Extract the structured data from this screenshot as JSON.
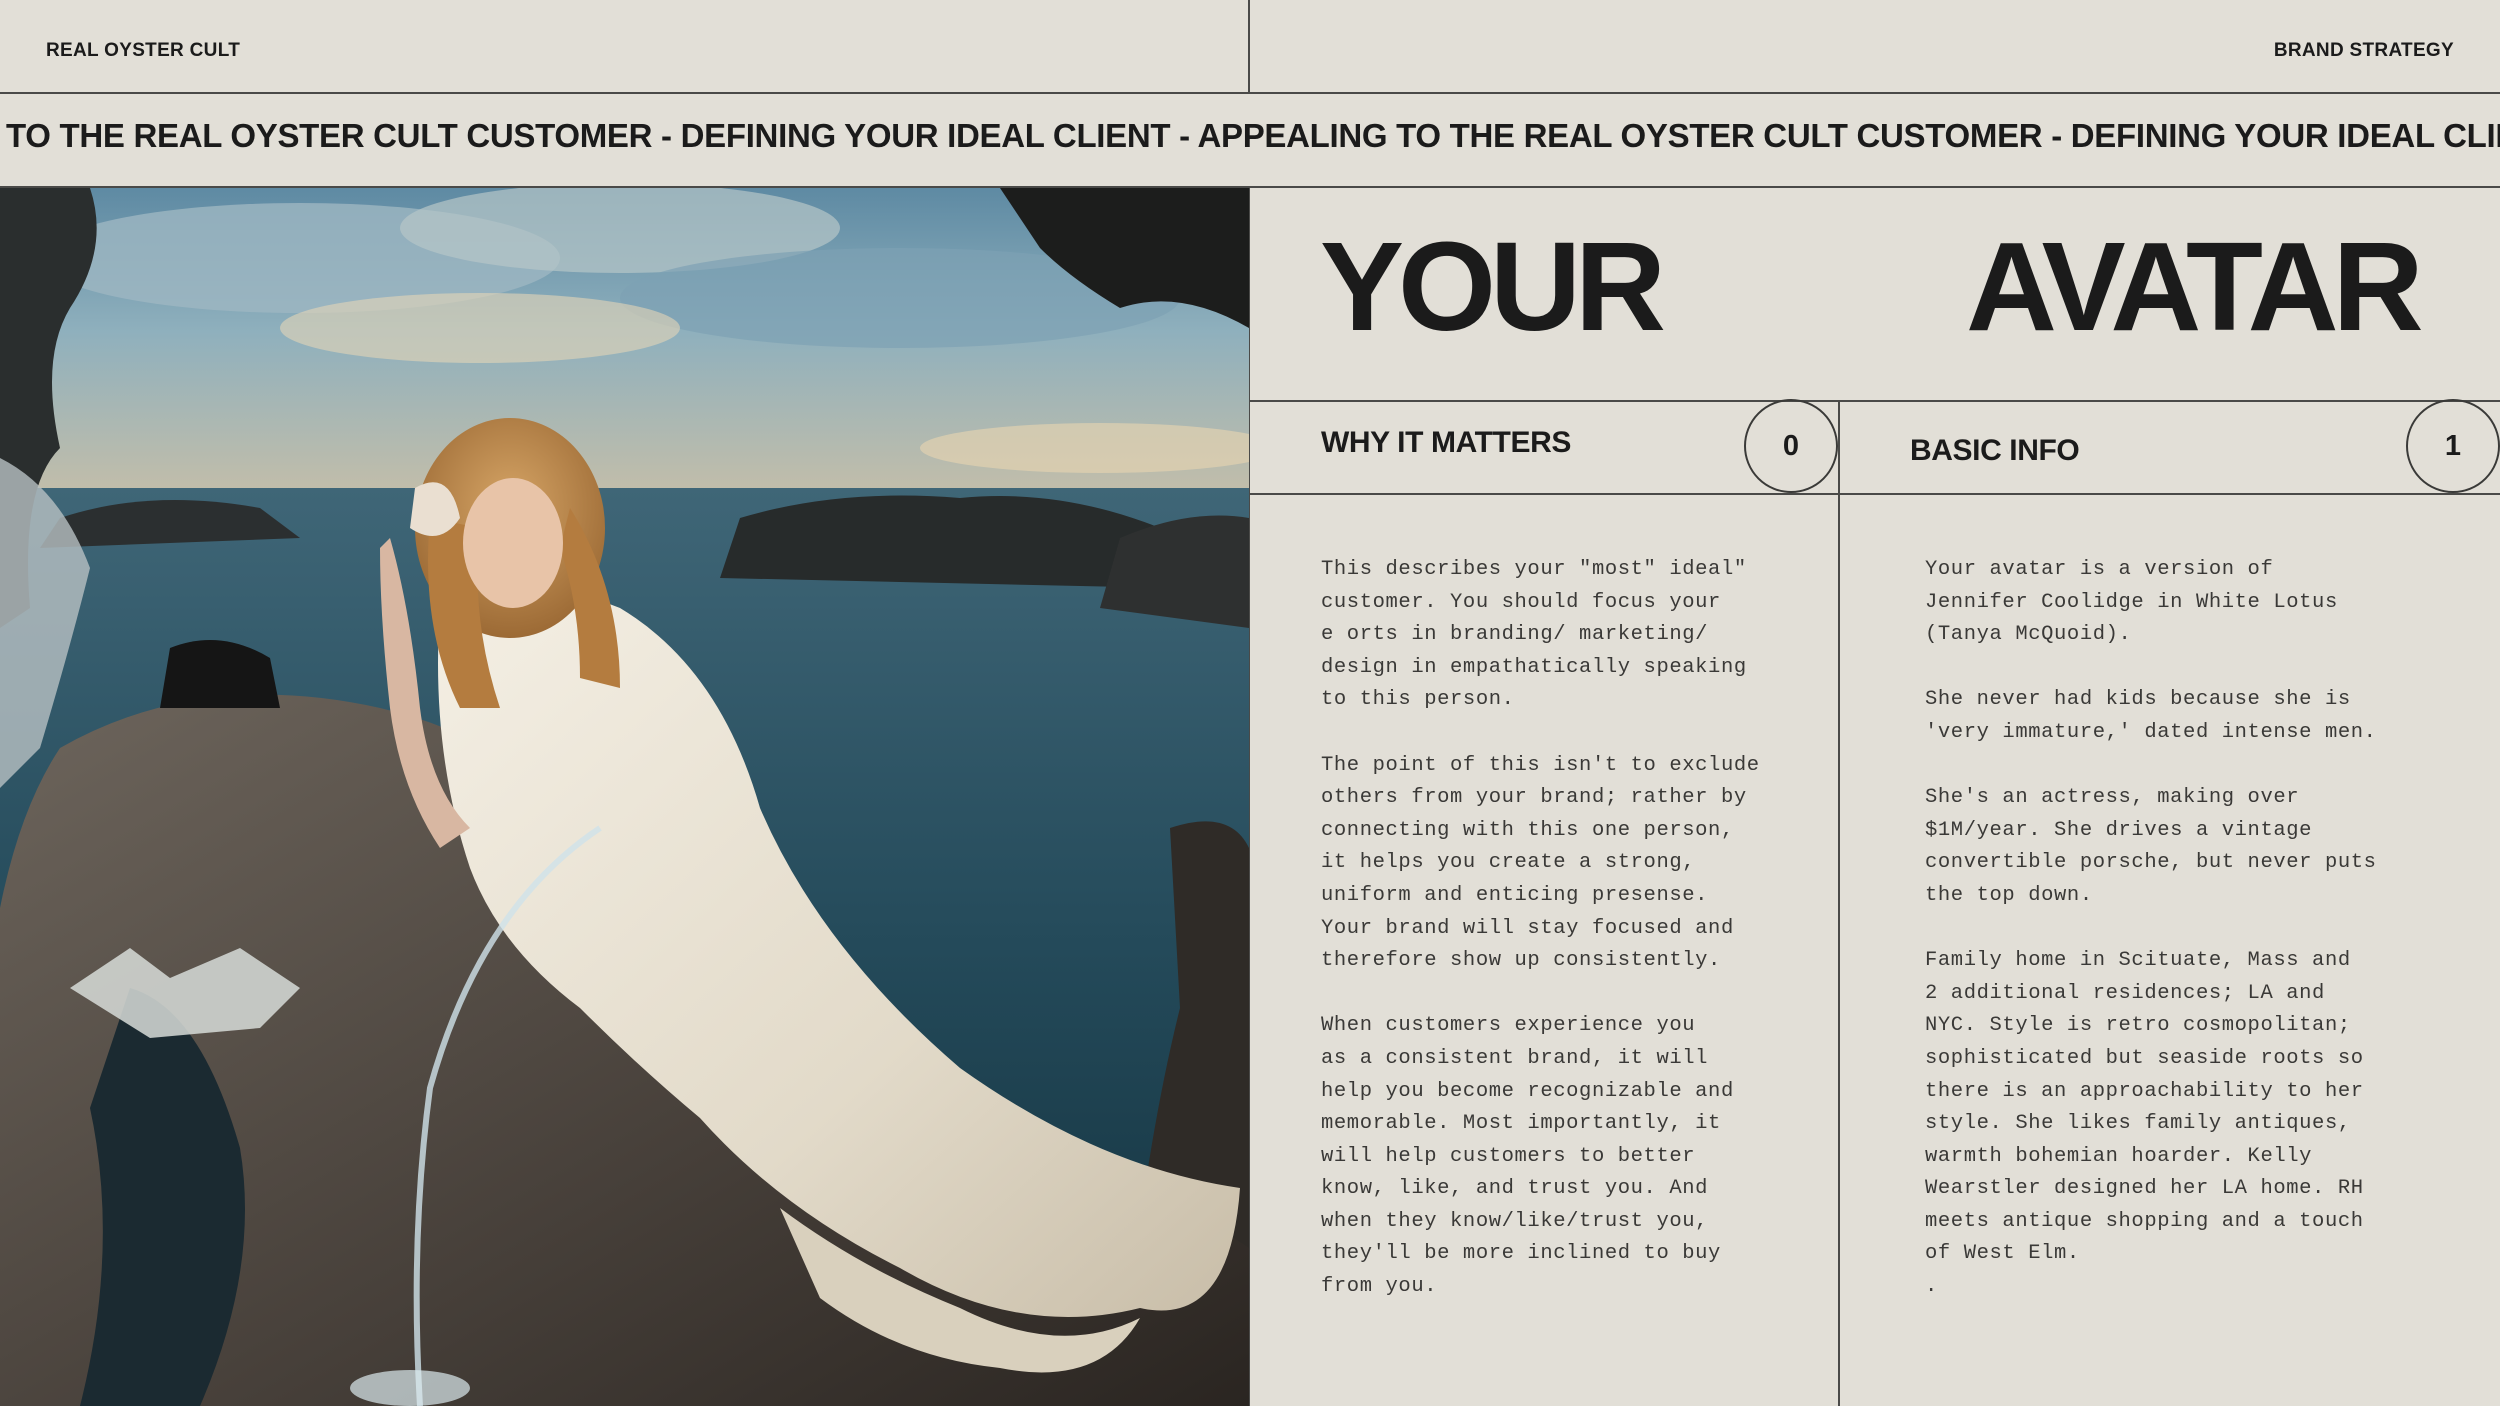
{
  "header": {
    "brand": "REAL OYSTER CULT",
    "section": "BRAND STRATEGY"
  },
  "ticker": {
    "text": "TO THE REAL OYSTER CULT CUSTOMER  - DEFINING YOUR IDEAL CLIENT  -  APPEALING TO THE REAL OYSTER CULT CUSTOMER  - DEFINING YOUR IDEAL CLIENT  -  APPEALING"
  },
  "photo": {
    "description": "woman-in-white-gown-on-rock"
  },
  "title": {
    "word_left": "YOUR",
    "word_right": "AVATAR"
  },
  "sections": [
    {
      "label": "WHY IT MATTERS",
      "number": "0",
      "paragraphs": [
        "This describes your \"most\" ideal\"\ncustomer. You should focus your\ne orts in branding/ marketing/\ndesign in empathatically speaking\nto this person.",
        "The point of this isn't to exclude\nothers from your brand; rather by\nconnecting with this one person,\nit helps you create a strong,\nuniform and enticing presense.\nYour brand will stay focused and\ntherefore show up consistently.",
        "When customers experience you\nas a consistent brand, it will\nhelp you become recognizable and\nmemorable. Most importantly, it\nwill help customers to better\nknow, like, and trust you. And\nwhen they know/like/trust you,\nthey'll be more inclined to buy\nfrom you."
      ]
    },
    {
      "label": "BASIC INFO",
      "number": "1",
      "paragraphs": [
        "Your avatar is a version of\nJennifer Coolidge in White Lotus\n(Tanya McQuoid).",
        "She never had kids because she is\n'very immature,' dated intense men.",
        "She's an actress, making over\n$1M/year. She drives a vintage\nconvertible porsche, but never puts\nthe top down.",
        "Family home in Scituate, Mass and\n2 additional residences; LA and\nNYC. Style is retro cosmopolitan;\nsophisticated but seaside roots so\nthere is an approachability to her\nstyle. She likes family antiques,\nwarmth bohemian hoarder. Kelly\nWearstler designed her LA home. RH\nmeets antique shopping and a touch\nof West Elm.\n."
      ]
    }
  ]
}
